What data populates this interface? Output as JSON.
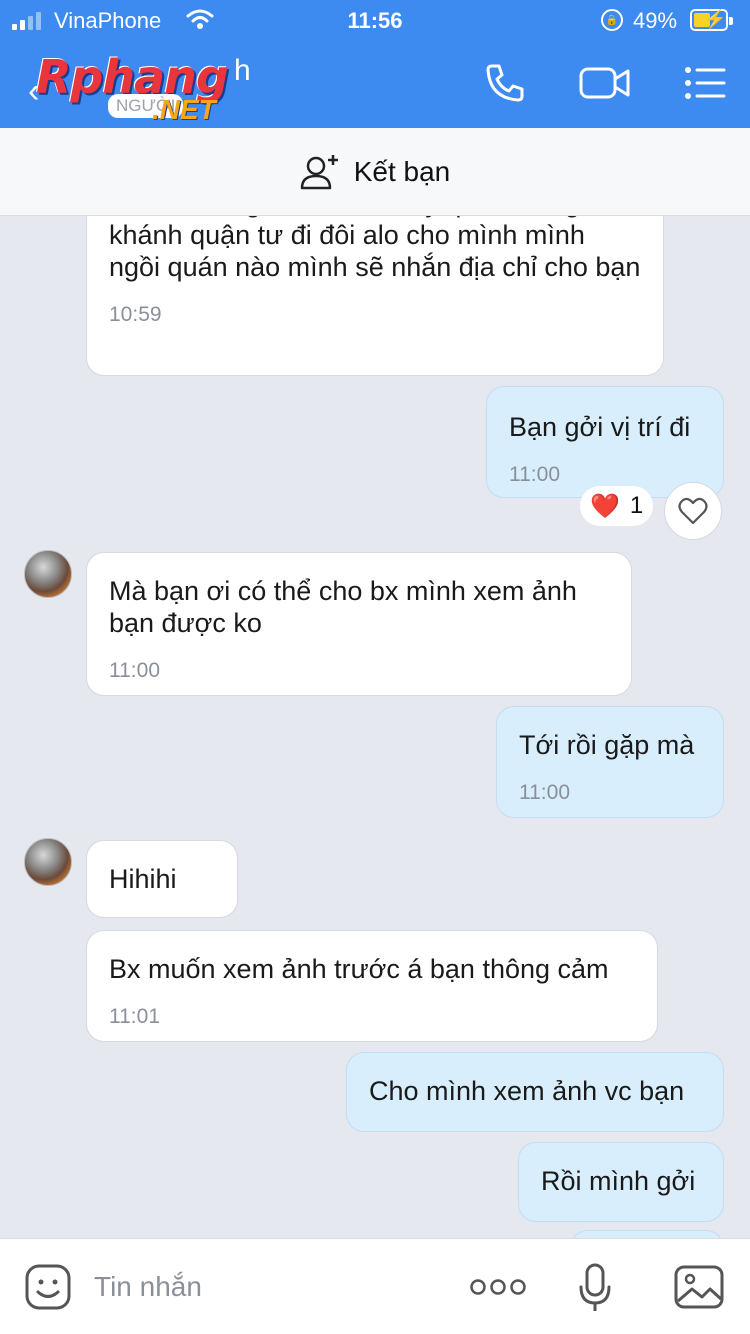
{
  "status_bar": {
    "carrier": "VinaPhone",
    "time": "11:56",
    "battery_percent": "49%",
    "signal_bars": 2
  },
  "nav": {
    "title": "h",
    "watermark": {
      "word": "Rphang",
      "tag": "NGƯỜI",
      "suffix": ".NET"
    }
  },
  "friend_bar": {
    "label": "Kết bạn"
  },
  "messages": [
    {
      "id": "m1",
      "side": "in",
      "text": "Khoản sau giờ rồi bạn chạy qua đường vĩnh khánh quận tư đi đôi alo cho mình mình ngồi quán nào mình sẽ nhắn địa chỉ cho bạn",
      "time": "10:59"
    },
    {
      "id": "m2",
      "side": "out",
      "text": "Bạn gởi vị trí đi",
      "time": "11:00",
      "reaction": {
        "emoji": "❤️",
        "count": "1"
      }
    },
    {
      "id": "m3",
      "side": "in",
      "text": "Mà bạn ơi có thể cho bx mình xem ảnh bạn được ko",
      "time": "11:00"
    },
    {
      "id": "m4",
      "side": "out",
      "text": "Tới rồi gặp mà",
      "time": "11:00"
    },
    {
      "id": "m5",
      "side": "in",
      "text": "Hihihi",
      "time": ""
    },
    {
      "id": "m6",
      "side": "in",
      "text": "Bx muốn xem ảnh trước á bạn thông cảm",
      "time": "11:01"
    },
    {
      "id": "m7",
      "side": "out",
      "text": "Cho mình xem ảnh vc bạn",
      "time": ""
    },
    {
      "id": "m8",
      "side": "out",
      "text": "Rồi mình gởi",
      "time": ""
    }
  ],
  "composer": {
    "placeholder": "Tin nhắn"
  },
  "colors": {
    "header": "#3d8af0",
    "chat_bg": "#e5e8ef",
    "incoming": "#ffffff",
    "outgoing": "#d9eefd"
  }
}
